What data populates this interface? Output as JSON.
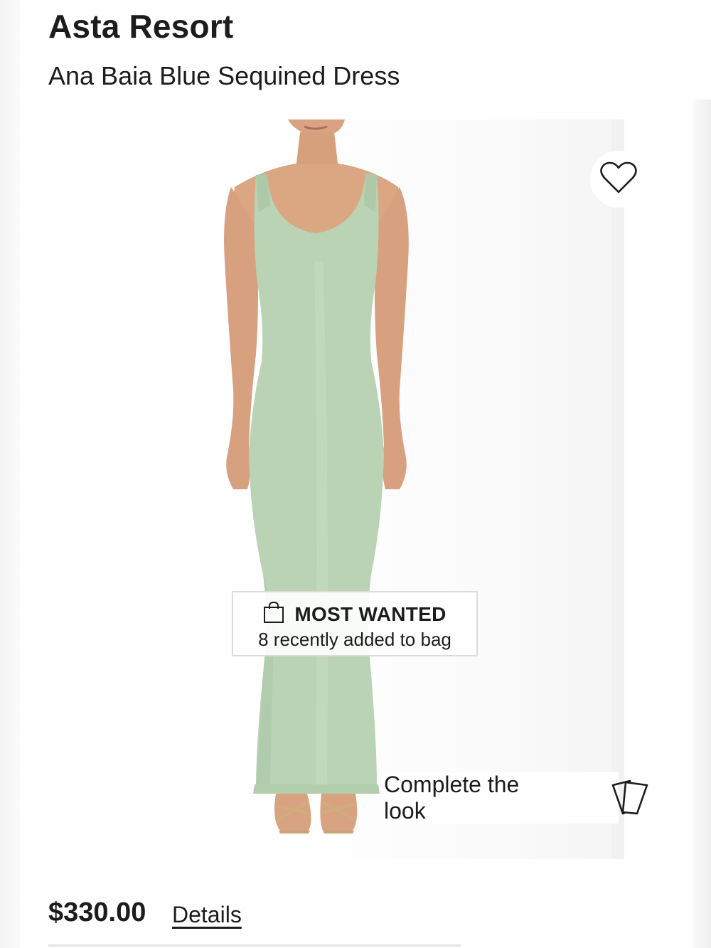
{
  "product": {
    "brand": "Asta Resort",
    "name": "Ana Baia Blue Sequined Dress",
    "price": "$330.00",
    "details_link": "Details"
  },
  "image": {
    "badge": {
      "title": "MOST WANTED",
      "subtitle": "8 recently added to bag",
      "icon": "shopping-bag-icon"
    },
    "wishlist_icon": "heart-icon",
    "complete_look": {
      "label": "Complete the look",
      "icon": "cards-icon"
    }
  },
  "colors": {
    "dress": "#b9d3b4",
    "skin": "#d9a381",
    "text": "#1c1c1c"
  }
}
